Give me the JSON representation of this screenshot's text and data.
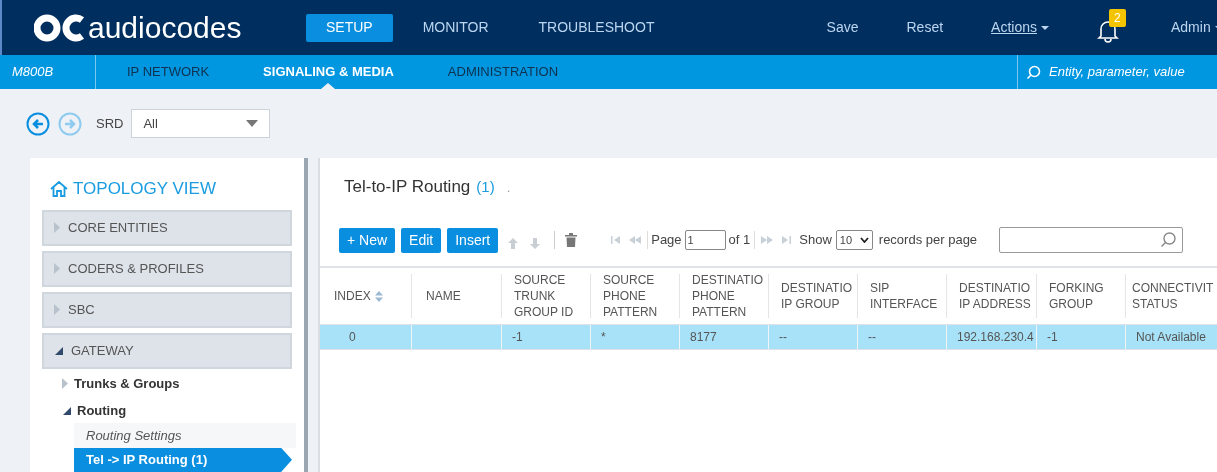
{
  "header": {
    "logo": "audiocodes",
    "tabs": [
      {
        "label": "SETUP",
        "selected": true
      },
      {
        "label": "MONITOR",
        "selected": false
      },
      {
        "label": "TROUBLESHOOT",
        "selected": false
      }
    ],
    "actions": [
      {
        "label": "Save",
        "kind": "plain"
      },
      {
        "label": "Reset",
        "kind": "plain"
      },
      {
        "label": "Actions",
        "kind": "menu"
      }
    ],
    "notifications": "2",
    "user": "Admin"
  },
  "subnav": {
    "device": "M800B",
    "tabs": [
      {
        "label": "IP NETWORK",
        "selected": false
      },
      {
        "label": "SIGNALING & MEDIA",
        "selected": true
      },
      {
        "label": "ADMINISTRATION",
        "selected": false
      }
    ],
    "search_placeholder": "Entity, parameter, value"
  },
  "toolbar": {
    "srd_label": "SRD",
    "srd_value": "All"
  },
  "sidebar": {
    "title": "TOPOLOGY VIEW",
    "sections": [
      {
        "label": "CORE ENTITIES",
        "expanded": false
      },
      {
        "label": "CODERS & PROFILES",
        "expanded": false
      },
      {
        "label": "SBC",
        "expanded": false
      },
      {
        "label": "GATEWAY",
        "expanded": true,
        "children": [
          {
            "label": "Trunks & Groups",
            "expanded": false
          },
          {
            "label": "Routing",
            "expanded": true,
            "children": [
              {
                "label": "Routing Settings",
                "selected": false
              },
              {
                "label": "Tel -> IP Routing (1)",
                "selected": true
              }
            ]
          }
        ]
      }
    ]
  },
  "main": {
    "title": "Tel-to-IP Routing",
    "count": "(1)",
    "dot": ".",
    "buttons": [
      "+ New",
      "Edit",
      "Insert"
    ],
    "pager": {
      "page_label": "Page",
      "page": "1",
      "of": "of 1",
      "show": "Show",
      "per_page": "10",
      "records": "records per page"
    },
    "table": {
      "columns": [
        "INDEX",
        "NAME",
        "SOURCE TRUNK GROUP ID",
        "SOURCE PHONE PATTERN",
        "DESTINATIO PHONE PATTERN",
        "DESTINATIO IP GROUP",
        "SIP INTERFACE",
        "DESTINATIO IP ADDRESS",
        "FORKING GROUP",
        "CONNECTIVIT STATUS"
      ],
      "rows": [
        {
          "selected": true,
          "cells": [
            "0",
            "",
            "-1",
            "*",
            "8177",
            "--",
            "--",
            "192.168.230.4",
            "-1",
            "Not Available"
          ]
        }
      ]
    }
  }
}
